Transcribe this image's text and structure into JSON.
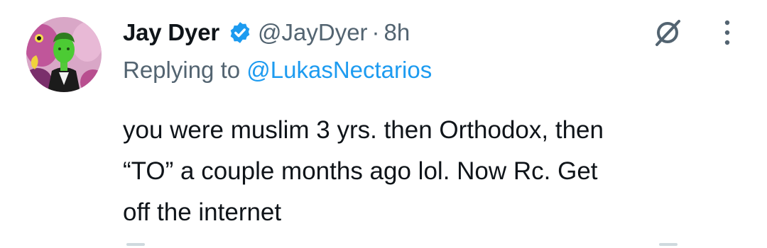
{
  "author": {
    "display_name": "Jay Dyer",
    "handle": "@JayDyer",
    "separator": "·",
    "timestamp": "8h",
    "verified": true
  },
  "reply": {
    "prefix": "Replying to ",
    "mention": "@LukasNectarios"
  },
  "tweet": {
    "text": "you were muslim 3 yrs. then Orthodox, then\n“TO” a couple months ago lol. Now Rc. Get\noff the internet"
  },
  "icons": {
    "verified": "verified-badge-icon",
    "grok": "grok-icon",
    "more": "more-options-icon"
  },
  "colors": {
    "primary_text": "#0f1419",
    "secondary_text": "#536471",
    "accent": "#1d9bf0"
  }
}
